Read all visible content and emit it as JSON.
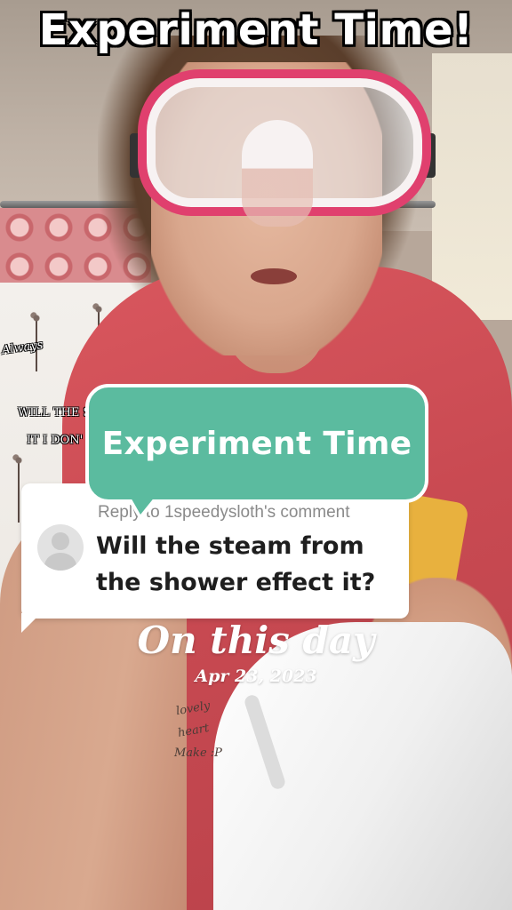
{
  "overlay": {
    "title": "Experiment Time!"
  },
  "curtain_text": {
    "line1": "WILL THE S",
    "line2": "IT I DON'",
    "script1": "Always",
    "script2": "lovely",
    "script3": "heart",
    "script4": "Make :P"
  },
  "comment": {
    "reply_to": "Reply to 1speedysloth's comment",
    "text": "Will the steam from the shower effect it?"
  },
  "bubble": {
    "label": "Experiment Time"
  },
  "memory": {
    "title": "On this day",
    "date": "Apr 23, 2023"
  },
  "colors": {
    "bubble": "#5bbb9f",
    "goggles": "#e0406e",
    "shirt": "#c94a52"
  }
}
